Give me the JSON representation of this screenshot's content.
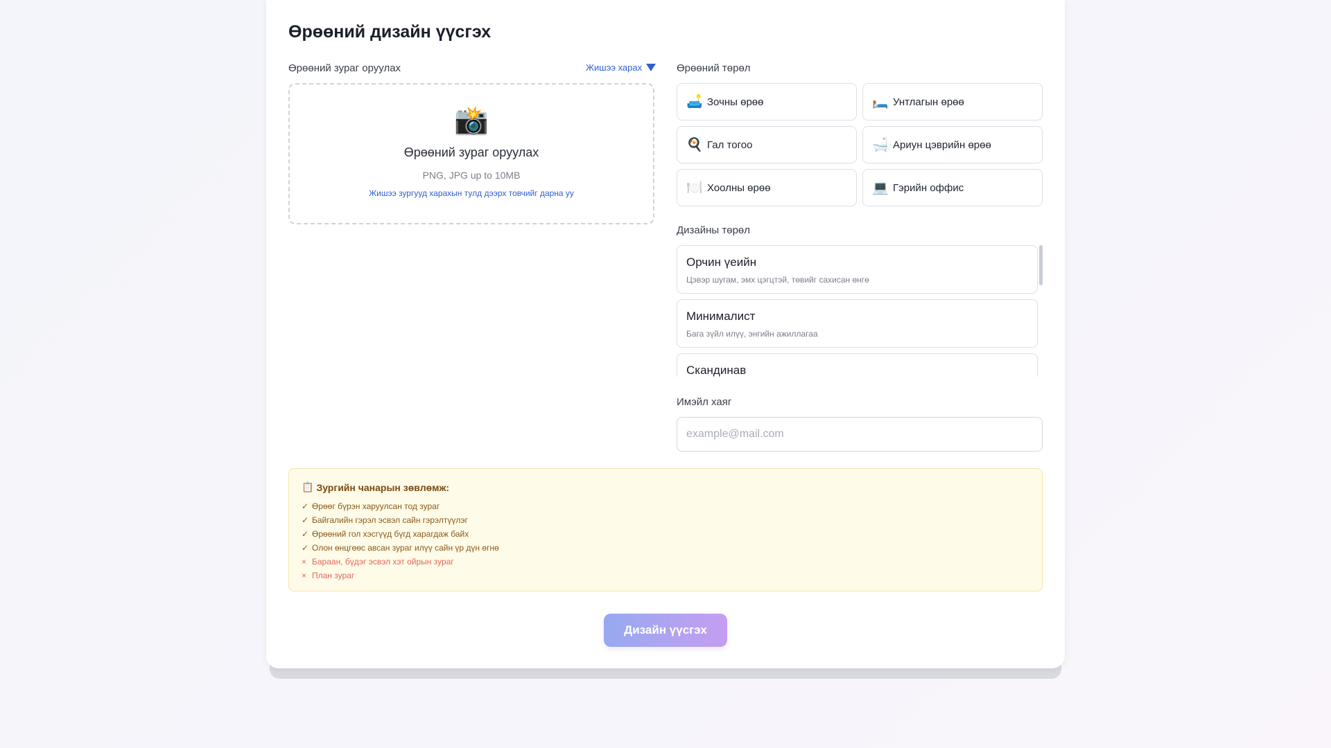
{
  "title": "Өрөөний дизайн үүсгэх",
  "upload": {
    "label": "Өрөөний зураг оруулах",
    "example_link": "Жишээ харах",
    "icon": "camera-icon",
    "icon_glyph": "📸",
    "dropzone_title": "Өрөөний зураг оруулах",
    "formats": "PNG, JPG up to 10MB",
    "hint": "Жишээ зургууд харахын тулд дээрх товчийг дарна уу"
  },
  "room_type": {
    "label": "Өрөөний төрөл",
    "items": [
      {
        "icon": "sofa-icon",
        "glyph": "🛋️",
        "label": "Зочны өрөө"
      },
      {
        "icon": "bed-icon",
        "glyph": "🛏️",
        "label": "Унтлагын өрөө"
      },
      {
        "icon": "frying-pan-icon",
        "glyph": "🍳",
        "label": "Гал тогоо"
      },
      {
        "icon": "bathtub-icon",
        "glyph": "🛁",
        "label": "Ариун цэврийн өрөө"
      },
      {
        "icon": "dining-plate-icon",
        "glyph": "🍽️",
        "label": "Хоолны өрөө"
      },
      {
        "icon": "laptop-icon",
        "glyph": "💻",
        "label": "Гэрийн оффис"
      }
    ]
  },
  "design_type": {
    "label": "Дизайны төрөл",
    "items": [
      {
        "name": "Орчин үеийн",
        "desc": "Цэвэр шугам, эмх цэгцтэй, төвийг сахисан өнгө"
      },
      {
        "name": "Минималист",
        "desc": "Бага зүйл илүү, энгийн ажиллагаа"
      },
      {
        "name": "Скандинав",
        "desc": ""
      }
    ]
  },
  "email": {
    "label": "Имэйл хаяг",
    "placeholder": "example@mail.com",
    "value": ""
  },
  "tips": {
    "icon": "notepad-icon",
    "glyph": "📋",
    "title": "Зургийн чанарын зөвлөмж:",
    "good": [
      "Өрөөг бүрэн харуулсан тод зураг",
      "Байгалийн гэрэл эсвэл сайн гэрэлтүүлэг",
      "Өрөөний гол хэсгүүд бүгд харагдаж байх",
      "Олон өнцгөөс авсан зураг илүү сайн үр дүн өгнө"
    ],
    "bad": [
      "Бараан, бүдэг эсвэл хэт ойрын зураг",
      "План зураг"
    ]
  },
  "submit": {
    "label": "Дизайн үүсгэх"
  },
  "colors": {
    "accent": "#2f5fd0",
    "button_start": "#97a9f1",
    "button_end": "#c59ef0",
    "tips_bg": "#fefbe8"
  }
}
